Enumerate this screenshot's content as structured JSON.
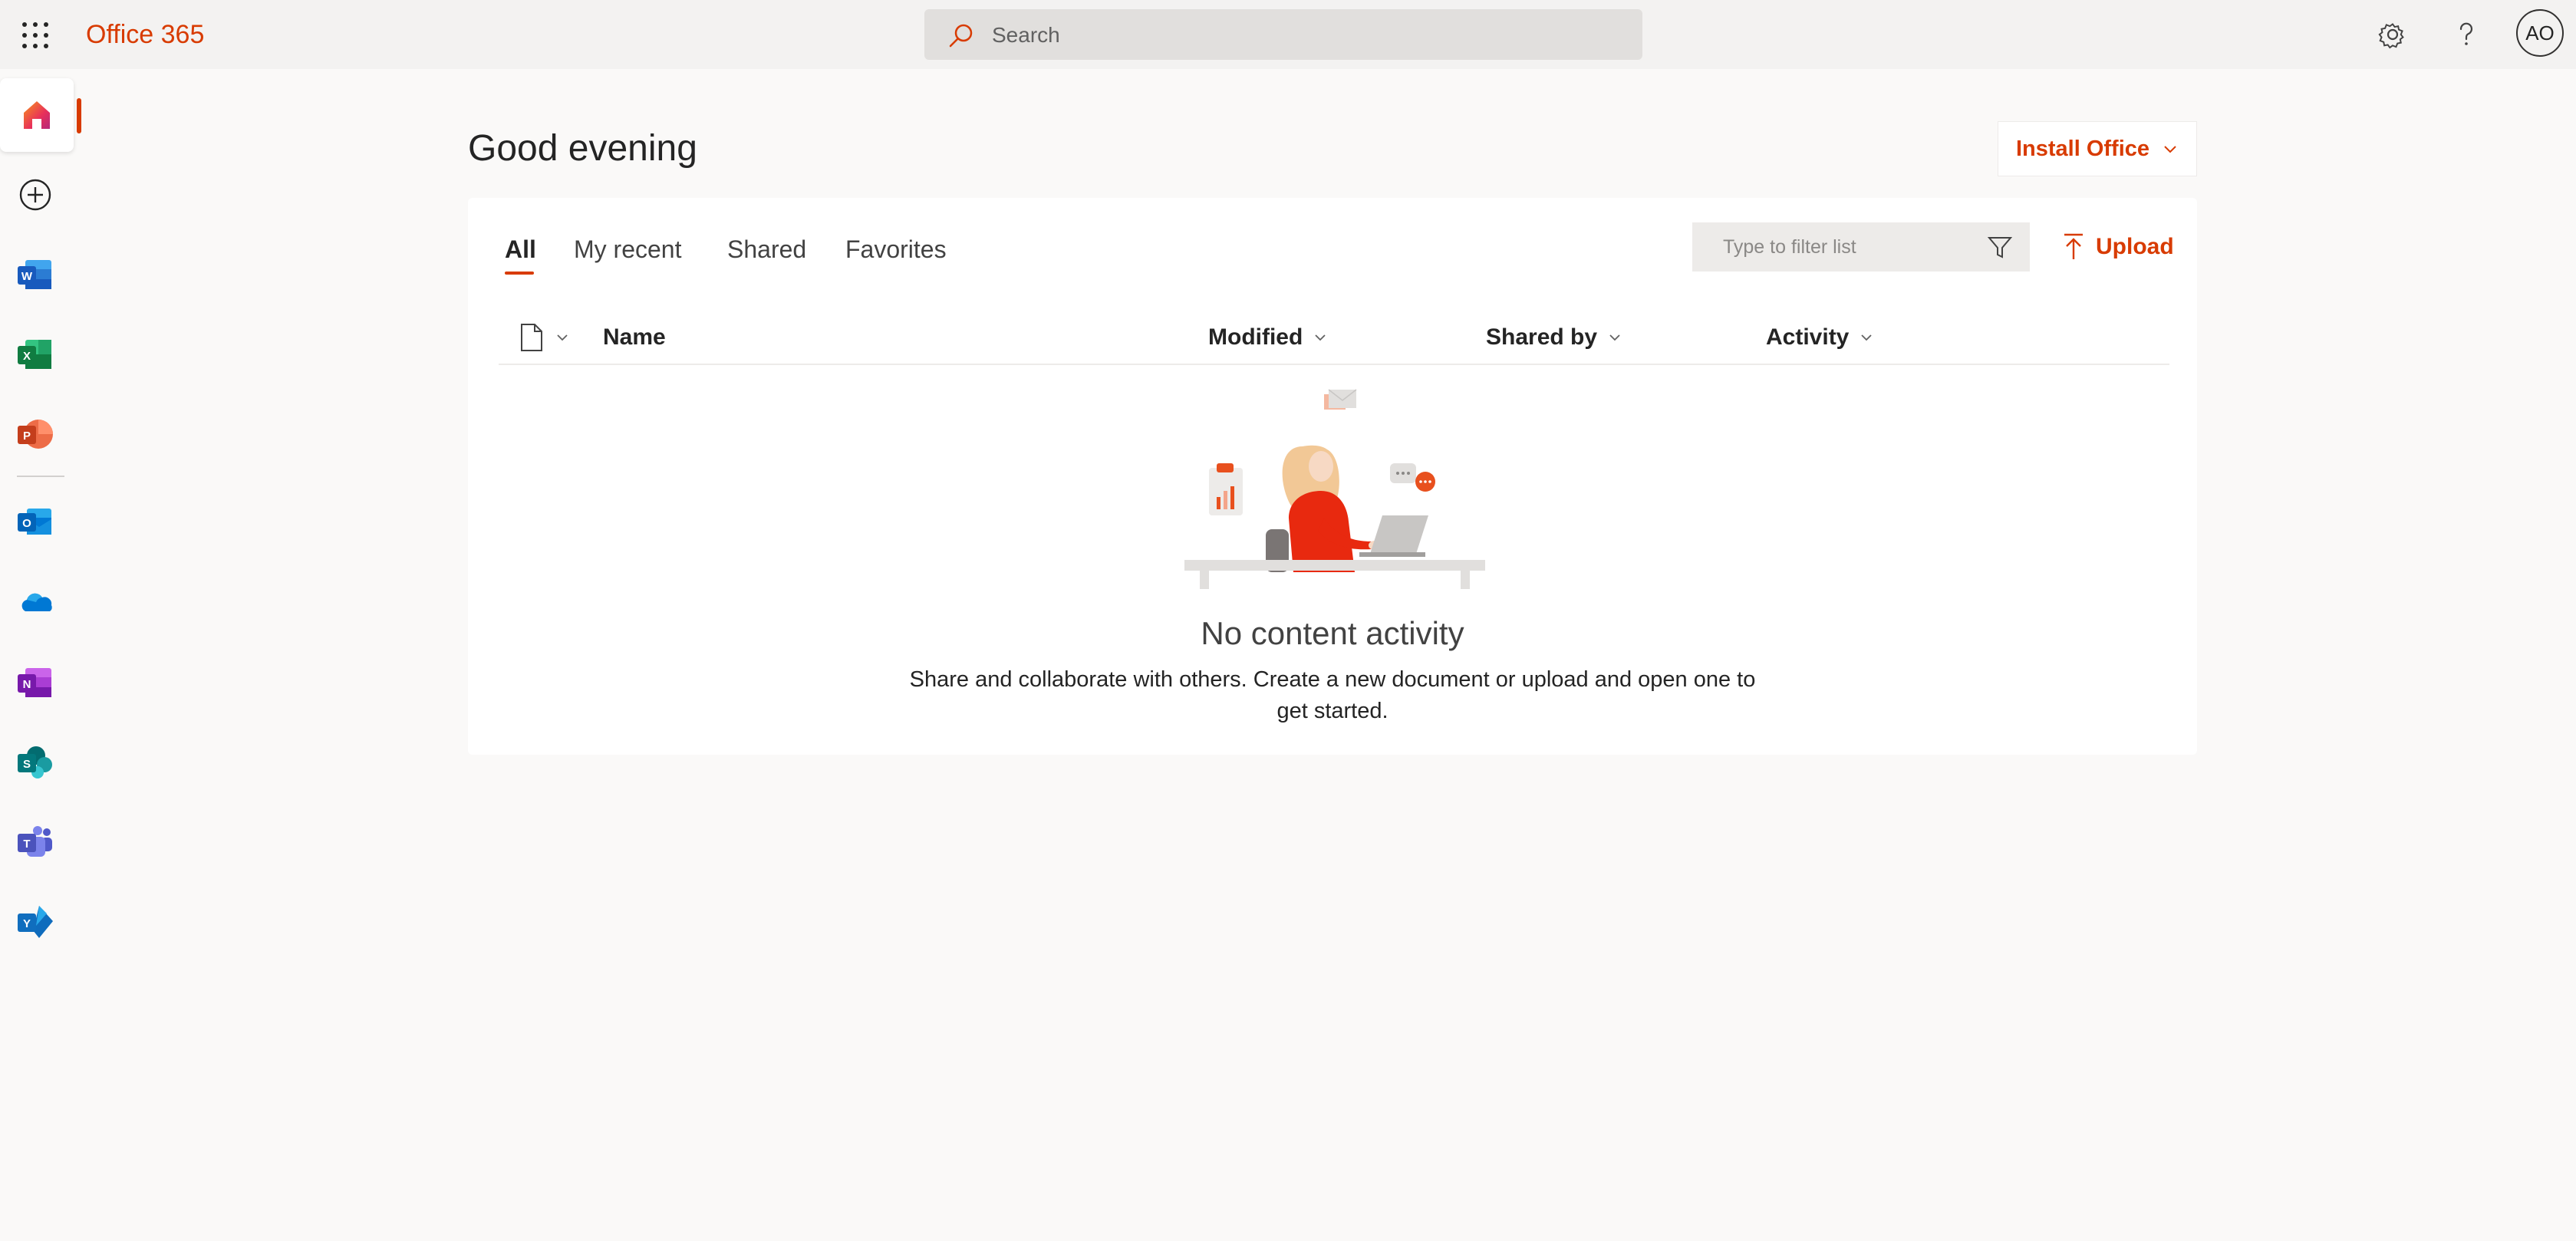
{
  "header": {
    "app_title": "Office 365",
    "search_placeholder": "Search",
    "avatar_initials": "AO"
  },
  "rail": {
    "items": [
      {
        "name": "home",
        "icon": "home-icon",
        "active": true
      },
      {
        "name": "create",
        "icon": "plus-circle-icon"
      },
      {
        "name": "word",
        "icon": "word-icon",
        "letter": "W",
        "color": "#185abd"
      },
      {
        "name": "excel",
        "icon": "excel-icon",
        "letter": "X",
        "color": "#107c41"
      },
      {
        "name": "powerpoint",
        "icon": "powerpoint-icon",
        "letter": "P",
        "color": "#c43e1c"
      },
      {
        "name": "outlook",
        "icon": "outlook-icon",
        "letter": "O",
        "color": "#0364b8"
      },
      {
        "name": "onedrive",
        "icon": "onedrive-icon",
        "color": "#0078d4"
      },
      {
        "name": "onenote",
        "icon": "onenote-icon",
        "letter": "N",
        "color": "#7719aa"
      },
      {
        "name": "sharepoint",
        "icon": "sharepoint-icon",
        "letter": "S",
        "color": "#03787c"
      },
      {
        "name": "teams",
        "icon": "teams-icon",
        "letter": "T",
        "color": "#5059c9"
      },
      {
        "name": "yammer",
        "icon": "yammer-icon",
        "letter": "Y",
        "color": "#106ebe"
      }
    ]
  },
  "main": {
    "greeting": "Good evening",
    "install_label": "Install Office",
    "tabs": [
      "All",
      "My recent",
      "Shared",
      "Favorites"
    ],
    "active_tab": "All",
    "filter_placeholder": "Type to filter list",
    "upload_label": "Upload",
    "columns": [
      "Name",
      "Modified",
      "Shared by",
      "Activity"
    ],
    "empty_title": "No content activity",
    "empty_description": "Share and collaborate with others. Create a new document or upload and open one to get started."
  },
  "colors": {
    "accent": "#d83b01",
    "page_bg": "#faf9f8",
    "topbar_bg": "#f3f2f1"
  }
}
